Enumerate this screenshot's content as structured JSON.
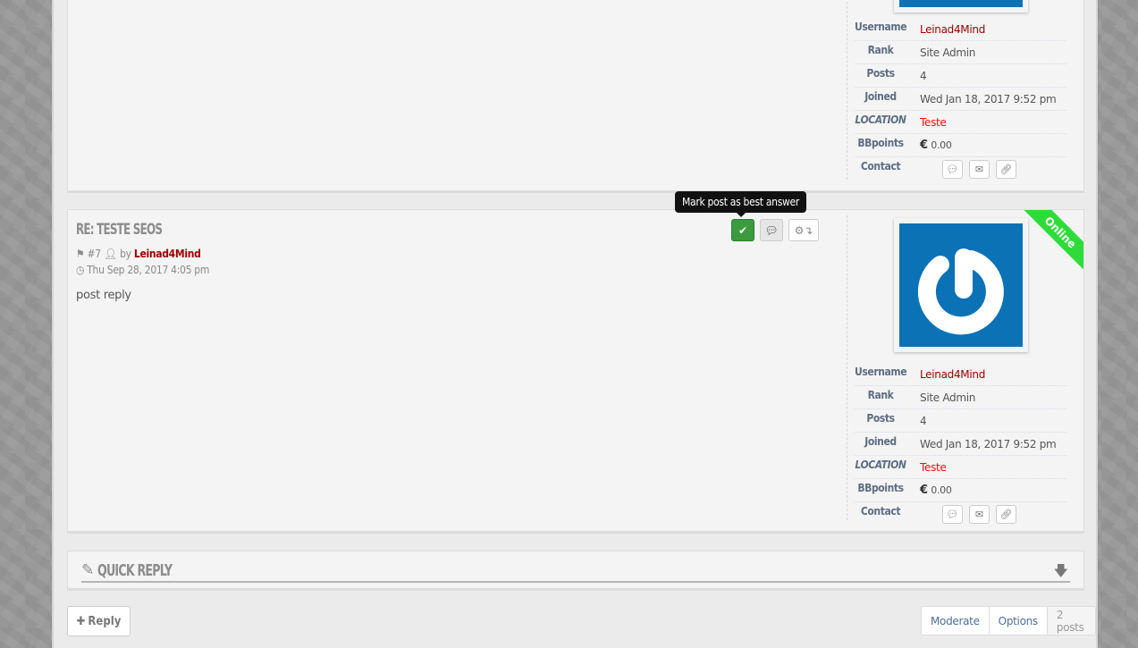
{
  "tooltip": "Mark post as best answer",
  "posts": [
    {
      "profile": {
        "username_label": "Username",
        "username": "Leinad4Mind",
        "rank_label": "Rank",
        "rank": "Site Admin",
        "posts_label": "Posts",
        "posts": "4",
        "joined_label": "Joined",
        "joined": "Wed Jan 18, 2017 9:52 pm",
        "location_label": "LOCATION",
        "location": "Teste",
        "bbpoints_label": "BBpoints",
        "bbpoints_currency": "€",
        "bbpoints": "0.00",
        "contact_label": "Contact"
      }
    },
    {
      "title": "RE: TESTE SEOS",
      "number": "#7",
      "by": "by",
      "author": "Leinad4Mind",
      "date": "Thu Sep 28, 2017 4:05 pm",
      "content": "post reply",
      "status_ribbon": "Online",
      "profile": {
        "username_label": "Username",
        "username": "Leinad4Mind",
        "rank_label": "Rank",
        "rank": "Site Admin",
        "posts_label": "Posts",
        "posts": "4",
        "joined_label": "Joined",
        "joined": "Wed Jan 18, 2017 9:52 pm",
        "location_label": "LOCATION",
        "location": "Teste",
        "bbpoints_label": "BBpoints",
        "bbpoints_currency": "€",
        "bbpoints": "0.00",
        "contact_label": "Contact"
      }
    }
  ],
  "quick_reply": {
    "title": "QUICK REPLY"
  },
  "footer": {
    "reply_label": "Reply",
    "moderate_label": "Moderate",
    "options_label": "Options",
    "post_count": "2 posts"
  },
  "colors": {
    "accent_author": "#a00000",
    "online": "#2fdb3b",
    "best_answer": "#3c9a3f",
    "avatar_bg": "#0b72b5"
  }
}
